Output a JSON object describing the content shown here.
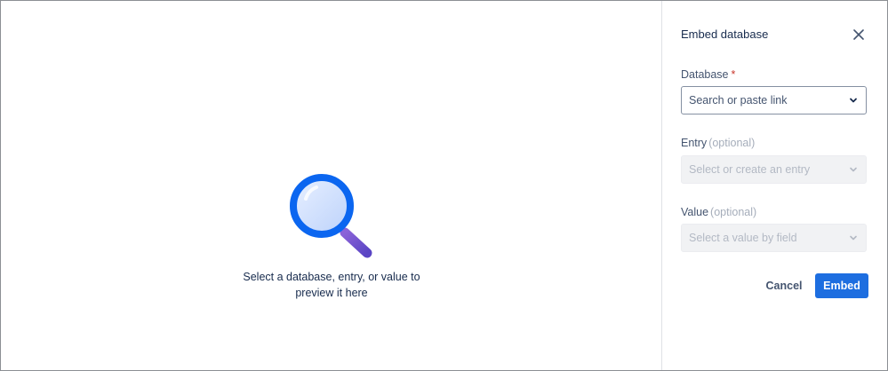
{
  "preview": {
    "illustration_icon": "magnifying-glass-icon",
    "message_line1": "Select a database, entry, or value to",
    "message_line2": "preview it here"
  },
  "panel": {
    "title": "Embed database",
    "close_icon": "close-icon",
    "database": {
      "label": "Database",
      "required_marker": "*",
      "placeholder": "Search or paste link"
    },
    "entry": {
      "label": "Entry",
      "optional": "(optional)",
      "placeholder": "Select or create an entry"
    },
    "value": {
      "label": "Value",
      "optional": "(optional)",
      "placeholder": "Select a value by field"
    },
    "cancel_label": "Cancel",
    "embed_label": "Embed"
  },
  "colors": {
    "accent": "#1d6ee0",
    "required": "#c9372c",
    "magnifier_ring": "#0b66f0",
    "magnifier_handle": "#6a4fcf"
  }
}
